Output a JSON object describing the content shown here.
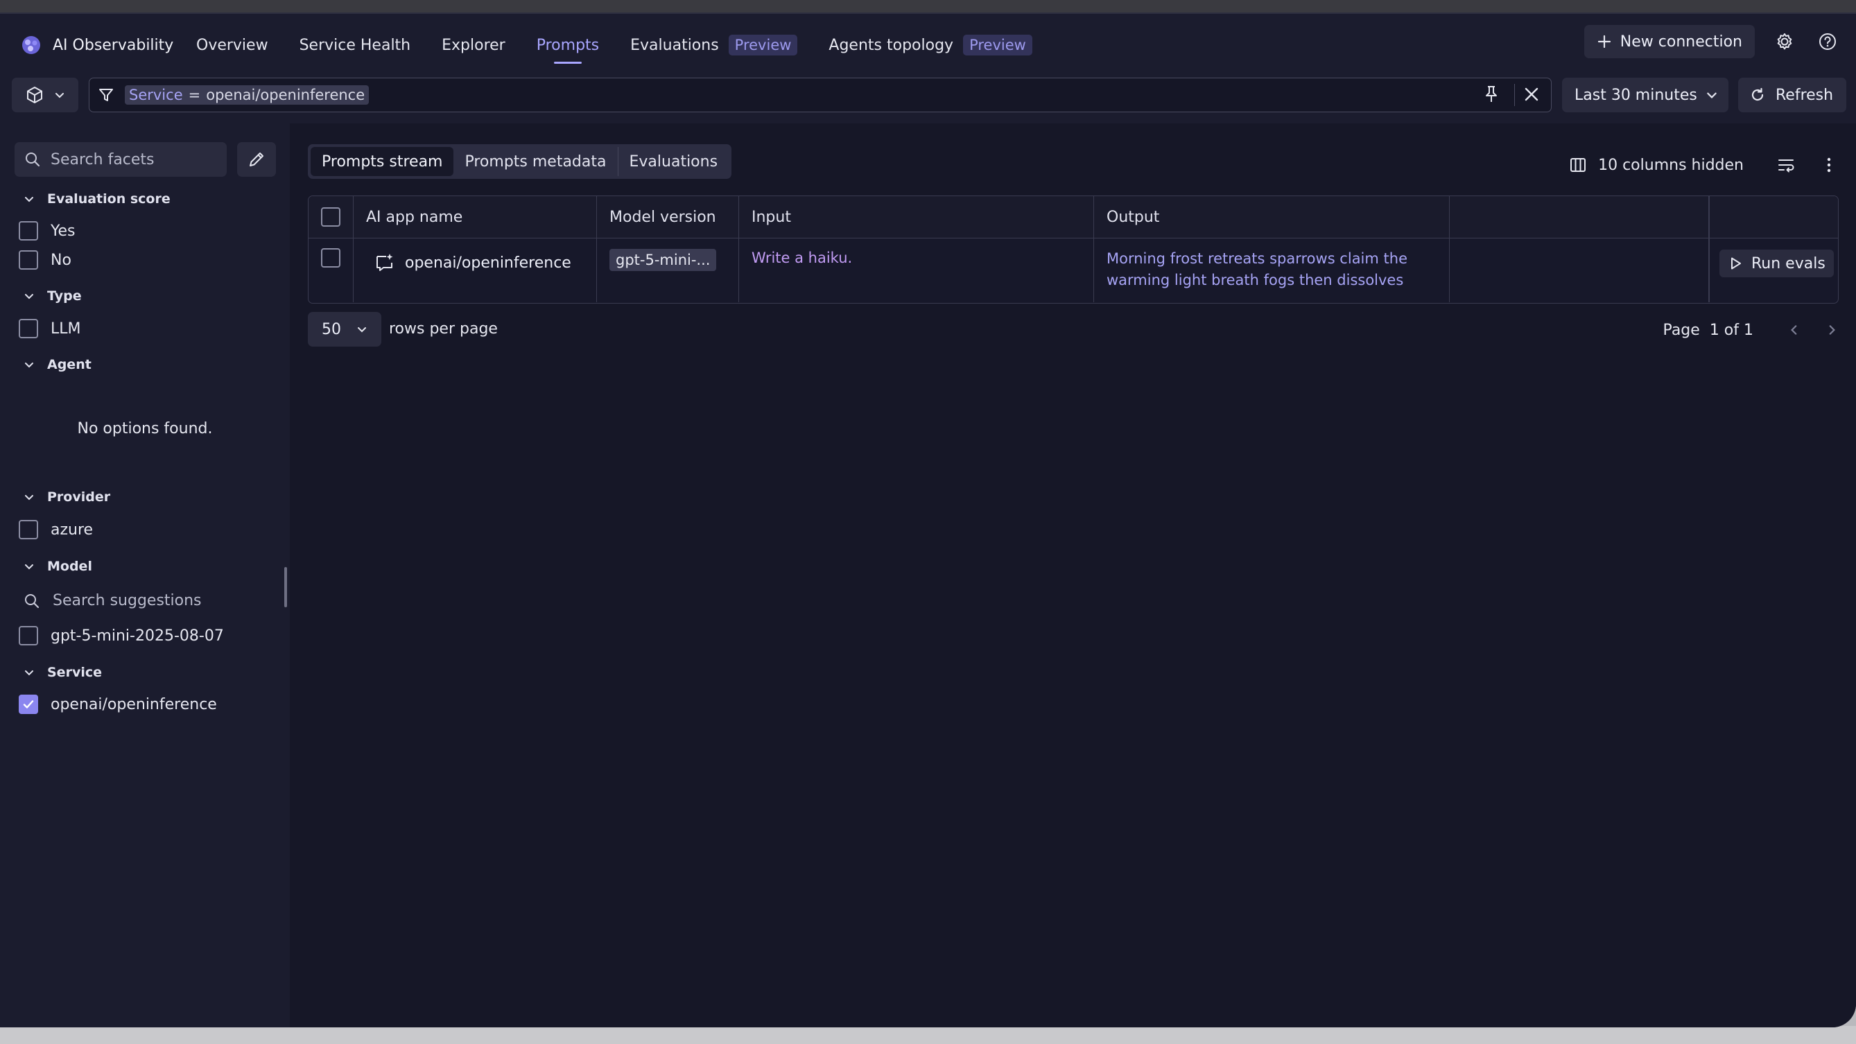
{
  "app": {
    "title": "AI Observability"
  },
  "nav": {
    "items": [
      {
        "label": "Overview"
      },
      {
        "label": "Service Health"
      },
      {
        "label": "Explorer"
      },
      {
        "label": "Prompts"
      },
      {
        "label": "Evaluations",
        "badge": "Preview"
      },
      {
        "label": "Agents topology",
        "badge": "Preview"
      }
    ],
    "new_connection": "New connection"
  },
  "filter": {
    "key": "Service",
    "op": "=",
    "value": "openai/openinference"
  },
  "timeframe": {
    "label": "Last 30 minutes"
  },
  "refresh": {
    "label": "Refresh"
  },
  "sidebar": {
    "search_placeholder": "Search facets",
    "sections": {
      "evaluation": {
        "title": "Evaluation score",
        "options": [
          "Yes",
          "No"
        ]
      },
      "type": {
        "title": "Type",
        "options": [
          "LLM"
        ]
      },
      "agent": {
        "title": "Agent",
        "empty": "No options found."
      },
      "provider": {
        "title": "Provider",
        "options": [
          "azure"
        ]
      },
      "model": {
        "title": "Model",
        "search_placeholder": "Search suggestions",
        "options": [
          "gpt-5-mini-2025-08-07"
        ]
      },
      "service": {
        "title": "Service",
        "options": [
          "openai/openinference"
        ]
      }
    }
  },
  "main": {
    "tabs": [
      "Prompts stream",
      "Prompts metadata",
      "Evaluations"
    ],
    "columns_hidden": "10 columns hidden",
    "table": {
      "headers": [
        "AI app name",
        "Model version",
        "Input",
        "Output"
      ],
      "rows": [
        {
          "app_name": "openai/openinference",
          "model_version": "gpt-5-mini-...",
          "input": "Write a haiku.",
          "output_line1": "Morning frost retreats sparrows claim the",
          "output_line2": "warming light breath fogs then dissolves",
          "action": "Run evals"
        }
      ]
    },
    "rows_per_page": {
      "value": "50",
      "label": "rows per page"
    },
    "pager": {
      "page_label": "Page",
      "page_value": "1 of 1"
    }
  },
  "colors": {
    "accent": "#a9a6ff",
    "background": "#1b1c2e",
    "panel": "#161727"
  }
}
